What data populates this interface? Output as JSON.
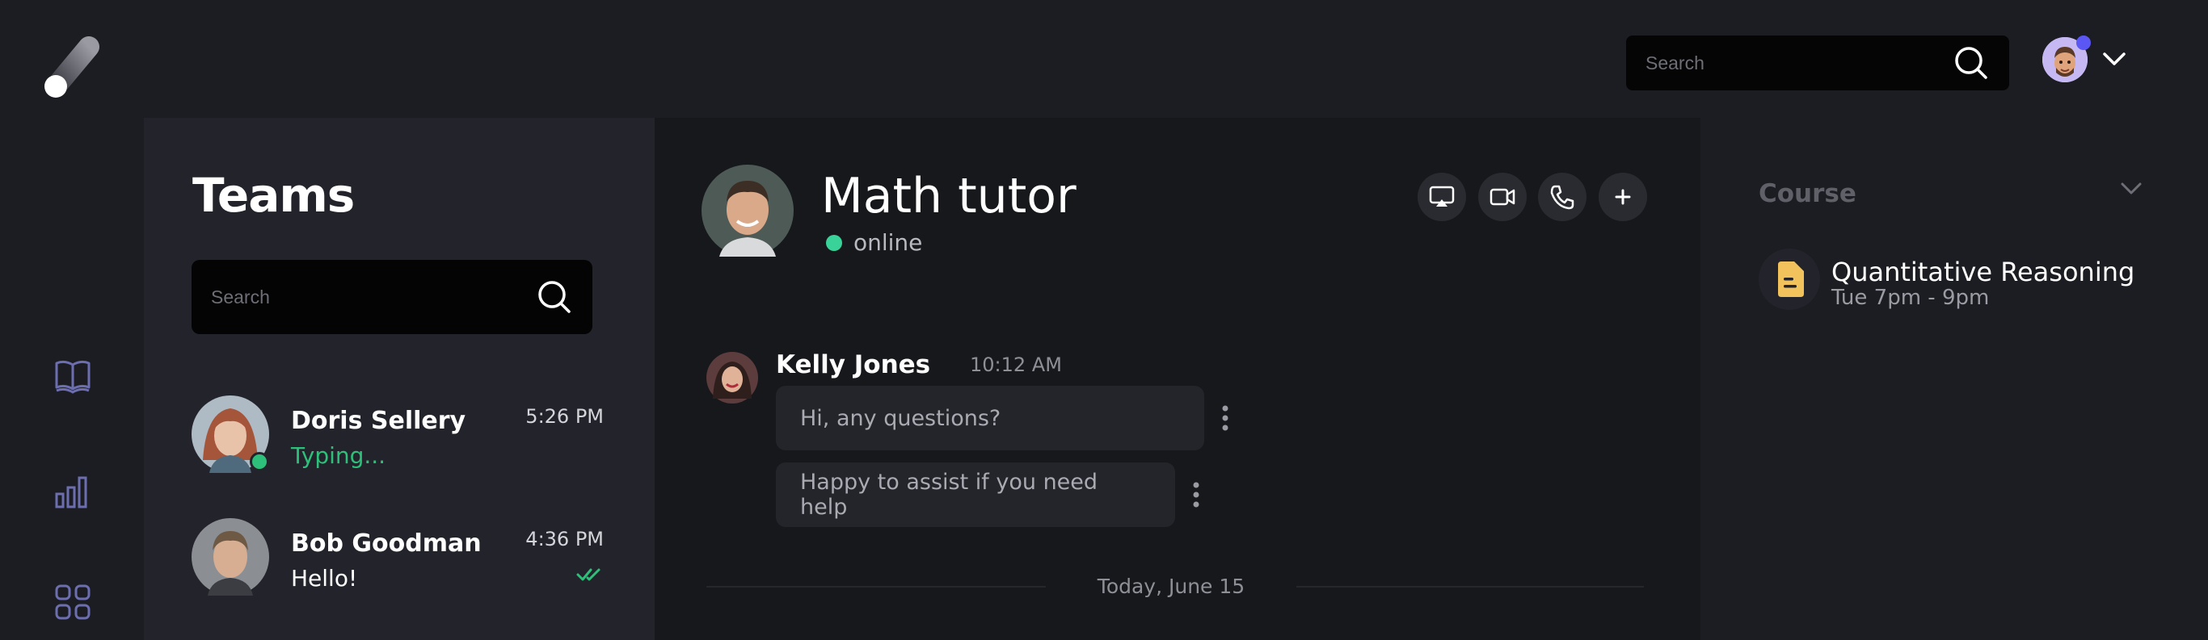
{
  "header": {
    "search_placeholder": "Search"
  },
  "colors": {
    "accent_online": "#39d399",
    "typing": "#2ec07a",
    "notification_dot": "#5b57f5",
    "course_icon": "#f2c25c"
  },
  "nav": {
    "items": [
      {
        "icon": "book-icon"
      },
      {
        "icon": "bar-chart-icon"
      },
      {
        "icon": "grid-icon"
      }
    ]
  },
  "teams": {
    "title": "Teams",
    "search_placeholder": "Search",
    "contacts": [
      {
        "name": "Doris Sellery",
        "time": "5:26 PM",
        "sub": "Typing...",
        "online": true
      },
      {
        "name": "Bob Goodman",
        "time": "4:36 PM",
        "sub": "Hello!",
        "read": true
      }
    ]
  },
  "chat": {
    "title": "Math tutor",
    "status": "online",
    "actions": [
      "screen-share-icon",
      "video-icon",
      "phone-icon",
      "plus-icon"
    ],
    "messages": {
      "sender": "Kelly Jones",
      "time": "10:12 AM",
      "items": [
        "Hi, any questions?",
        "Happy to assist if you need help"
      ]
    },
    "date_divider": "Today, June 15"
  },
  "course": {
    "label": "Course",
    "name": "Quantitative Reasoning",
    "time": "Tue 7pm - 9pm"
  }
}
